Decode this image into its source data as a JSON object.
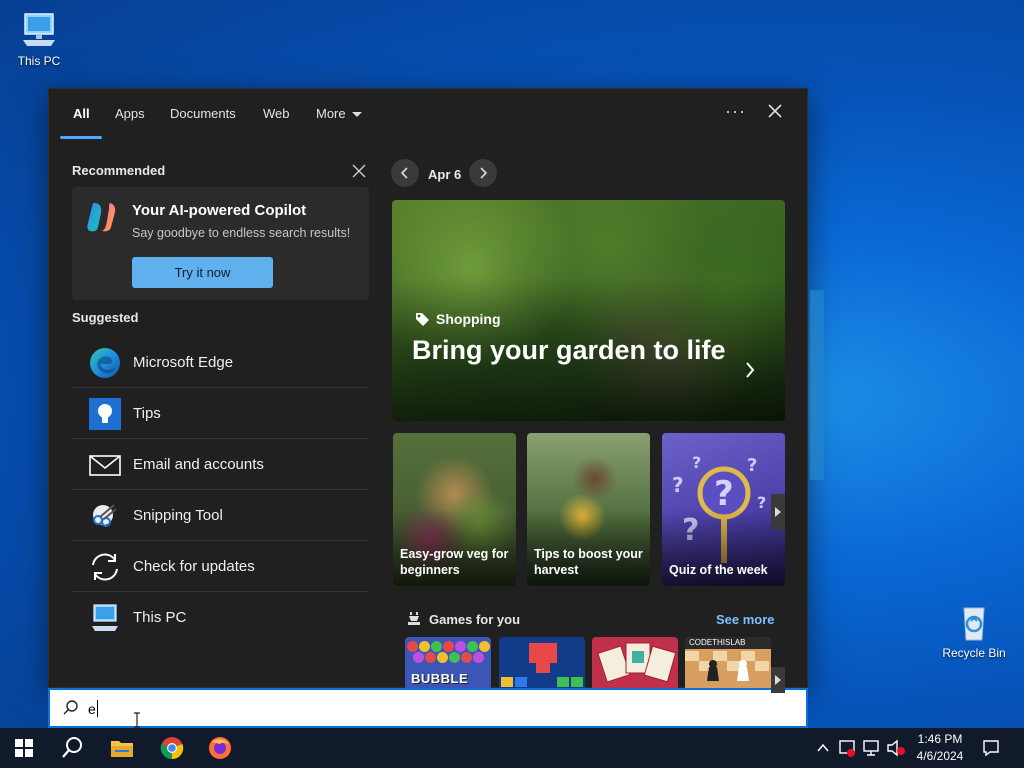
{
  "desktop": {
    "this_pc_label": "This PC",
    "recycle_bin_label": "Recycle Bin"
  },
  "tabs": [
    {
      "label": "All",
      "active": true
    },
    {
      "label": "Apps"
    },
    {
      "label": "Documents"
    },
    {
      "label": "Web"
    },
    {
      "label": "More"
    }
  ],
  "recommended": {
    "title": "Recommended",
    "card": {
      "title": "Your AI-powered Copilot",
      "subtitle": "Say goodbye to endless search results!",
      "button": "Try it now"
    }
  },
  "suggested": {
    "title": "Suggested",
    "items": [
      {
        "label": "Microsoft Edge",
        "icon": "edge-icon"
      },
      {
        "label": "Tips",
        "icon": "tips-icon"
      },
      {
        "label": "Email and accounts",
        "icon": "mail-icon"
      },
      {
        "label": "Snipping Tool",
        "icon": "snipping-tool-icon"
      },
      {
        "label": "Check for updates",
        "icon": "update-icon"
      },
      {
        "label": "This PC",
        "icon": "this-pc-icon"
      }
    ]
  },
  "highlights": {
    "date": "Apr 6",
    "hero": {
      "tag": "Shopping",
      "title": "Bring your garden to life"
    },
    "tiles": [
      {
        "label": "Easy-grow veg for beginners"
      },
      {
        "label": "Tips to boost your harvest"
      },
      {
        "label": "Quiz of the week"
      }
    ]
  },
  "games": {
    "title": "Games for you",
    "see_more": "See more",
    "items": [
      {
        "label": "BUBBLE SHOOTER"
      },
      {
        "label": ""
      },
      {
        "label": ""
      },
      {
        "label": "CODETHISLAB"
      }
    ]
  },
  "search": {
    "value": "e"
  },
  "clock": {
    "time": "1:46 PM",
    "date": "4/6/2024"
  },
  "colors": {
    "accent": "#4ca9ff",
    "panel_bg": "#202020",
    "taskbar_bg": "#101a2a"
  }
}
